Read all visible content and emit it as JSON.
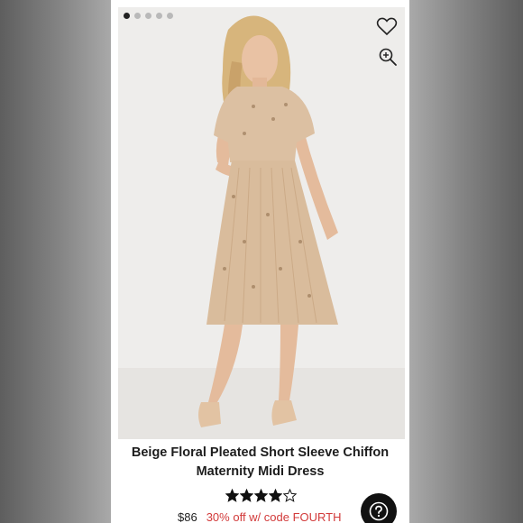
{
  "product": {
    "title_line1": "Beige Floral Pleated Short Sleeve Chiffon",
    "title_line2": "Maternity Midi Dress",
    "rating": 4,
    "rating_max": 5,
    "price": "$86",
    "promo": "30% off w/ code FOURTH"
  },
  "gallery": {
    "image_count": 5,
    "active_index": 0
  },
  "icons": {
    "favorite": "heart-outline-icon",
    "zoom": "zoom-in-icon",
    "help": "question-mark-icon"
  },
  "colors": {
    "promo": "#d23a3a",
    "dress": "#dcc0a2",
    "help_button": "#111111"
  }
}
